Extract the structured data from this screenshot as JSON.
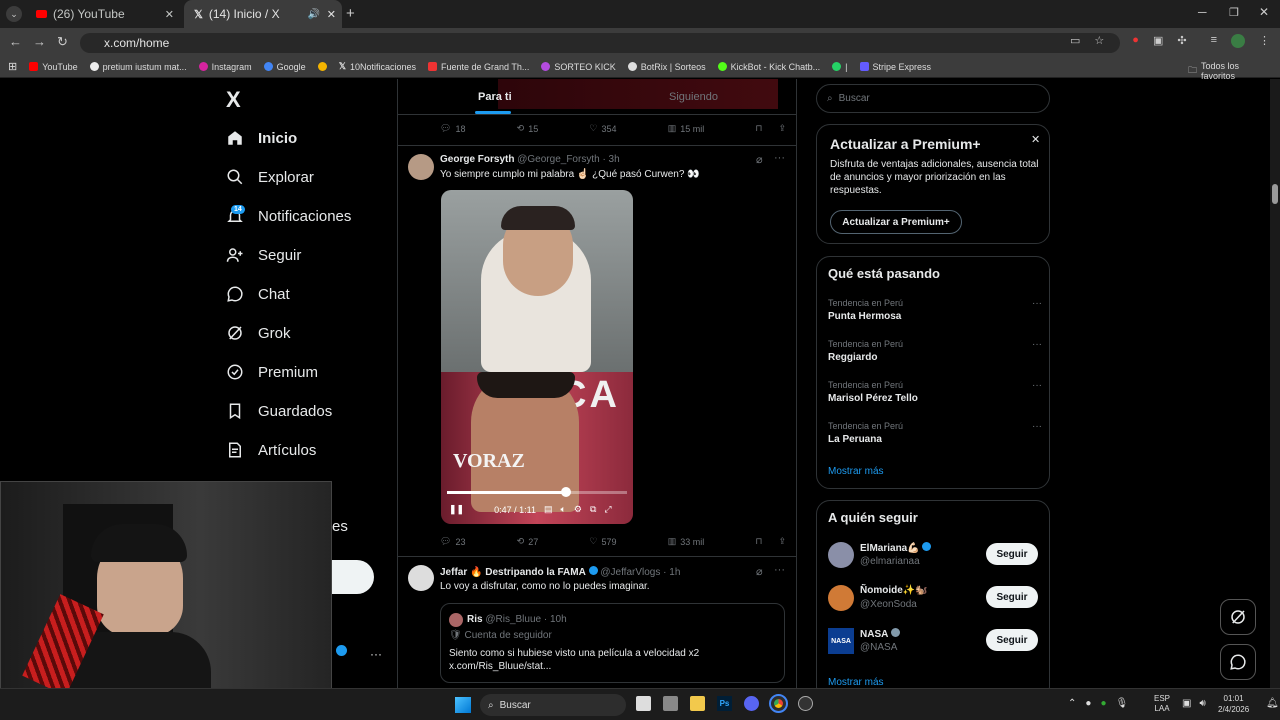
{
  "browser": {
    "tabs": [
      {
        "title": "(26) YouTube"
      },
      {
        "title": "(14) Inicio / X"
      }
    ],
    "url": "x.com/home",
    "bookmarks": [
      "YouTube",
      "pretium iustum mat...",
      "Instagram",
      "Google",
      "10Notificaciones",
      "Fuente de Grand Th...",
      "SORTEO KICK",
      "BotRix | Sorteos",
      "KickBot - Kick Chatb...",
      "|",
      "Stripe Express"
    ],
    "all_bookmarks": "Todos los favoritos"
  },
  "sidebar": {
    "logo": "X",
    "items": [
      {
        "label": "Inicio",
        "icon": "home-icon"
      },
      {
        "label": "Explorar",
        "icon": "search-icon"
      },
      {
        "label": "Notificaciones",
        "icon": "bell-icon",
        "badge": "14"
      },
      {
        "label": "Seguir",
        "icon": "add-user-icon"
      },
      {
        "label": "Chat",
        "icon": "chat-icon"
      },
      {
        "label": "Grok",
        "icon": "grok-icon"
      },
      {
        "label": "Premium",
        "icon": "premium-icon"
      },
      {
        "label": "Guardados",
        "icon": "bookmark-icon"
      },
      {
        "label": "Artículos",
        "icon": "article-icon"
      }
    ],
    "partial_label": "es"
  },
  "feed": {
    "tabs": [
      "Para ti",
      "Siguiendo"
    ],
    "top_stats": {
      "replies": "18",
      "reposts": "15",
      "likes": "354",
      "views": "15 mil"
    },
    "post1": {
      "name": "George Forsyth",
      "handle": "@George_Forsyth",
      "time": "· 3h",
      "text": "Yo siempre cumplo mi palabra ☝🏻 ¿Qué pasó Curwen? 👀",
      "video_overlay": "VORAZ",
      "video_bg_text": "CA",
      "video_time": "0:47 / 1:11",
      "video_progress": 0.66,
      "stats": {
        "replies": "23",
        "reposts": "27",
        "likes": "579",
        "views": "33 mil"
      }
    },
    "post2": {
      "name": "Jeffar 🔥 Destripando la FAMA",
      "handle": "@JeffarVlogs",
      "time": "· 1h",
      "text": "Lo voy a disfrutar, como no lo puedes imaginar.",
      "quote": {
        "name": "Ris",
        "handle": "@Ris_Bluue",
        "time": "· 10h",
        "subtitle": "Cuenta de seguidor",
        "text": "Siento como si hubiese visto una película a velocidad x2",
        "link": "x.com/Ris_Bluue/stat..."
      }
    }
  },
  "right": {
    "search_placeholder": "Buscar",
    "premium": {
      "title": "Actualizar a Premium+",
      "body": "Disfruta de ventajas adicionales, ausencia total de anuncios y mayor priorización en las respuestas.",
      "button": "Actualizar a Premium+"
    },
    "trends": {
      "title": "Qué está pasando",
      "items": [
        {
          "context": "Tendencia en Perú",
          "name": "Punta Hermosa"
        },
        {
          "context": "Tendencia en Perú",
          "name": "Reggiardo"
        },
        {
          "context": "Tendencia en Perú",
          "name": "Marisol Pérez Tello"
        },
        {
          "context": "Tendencia en Perú",
          "name": "La Peruana"
        }
      ],
      "more": "Mostrar más"
    },
    "follow": {
      "title": "A quién seguir",
      "items": [
        {
          "name": "ElMariana💪🏻",
          "handle": "@elmarianaa",
          "button": "Seguir"
        },
        {
          "name": "Ñomoide✨🐿️",
          "handle": "@XeonSoda",
          "button": "Seguir"
        },
        {
          "name": "NASA",
          "handle": "@NASA",
          "button": "Seguir"
        }
      ],
      "more": "Mostrar más"
    }
  },
  "taskbar": {
    "search": "Buscar",
    "lang1": "ESP",
    "lang2": "LAA",
    "time": "01:01",
    "date": "2/4/2026"
  },
  "colors": {
    "accent": "#1d9bf0",
    "bg": "#000000",
    "border": "#2f3336"
  }
}
